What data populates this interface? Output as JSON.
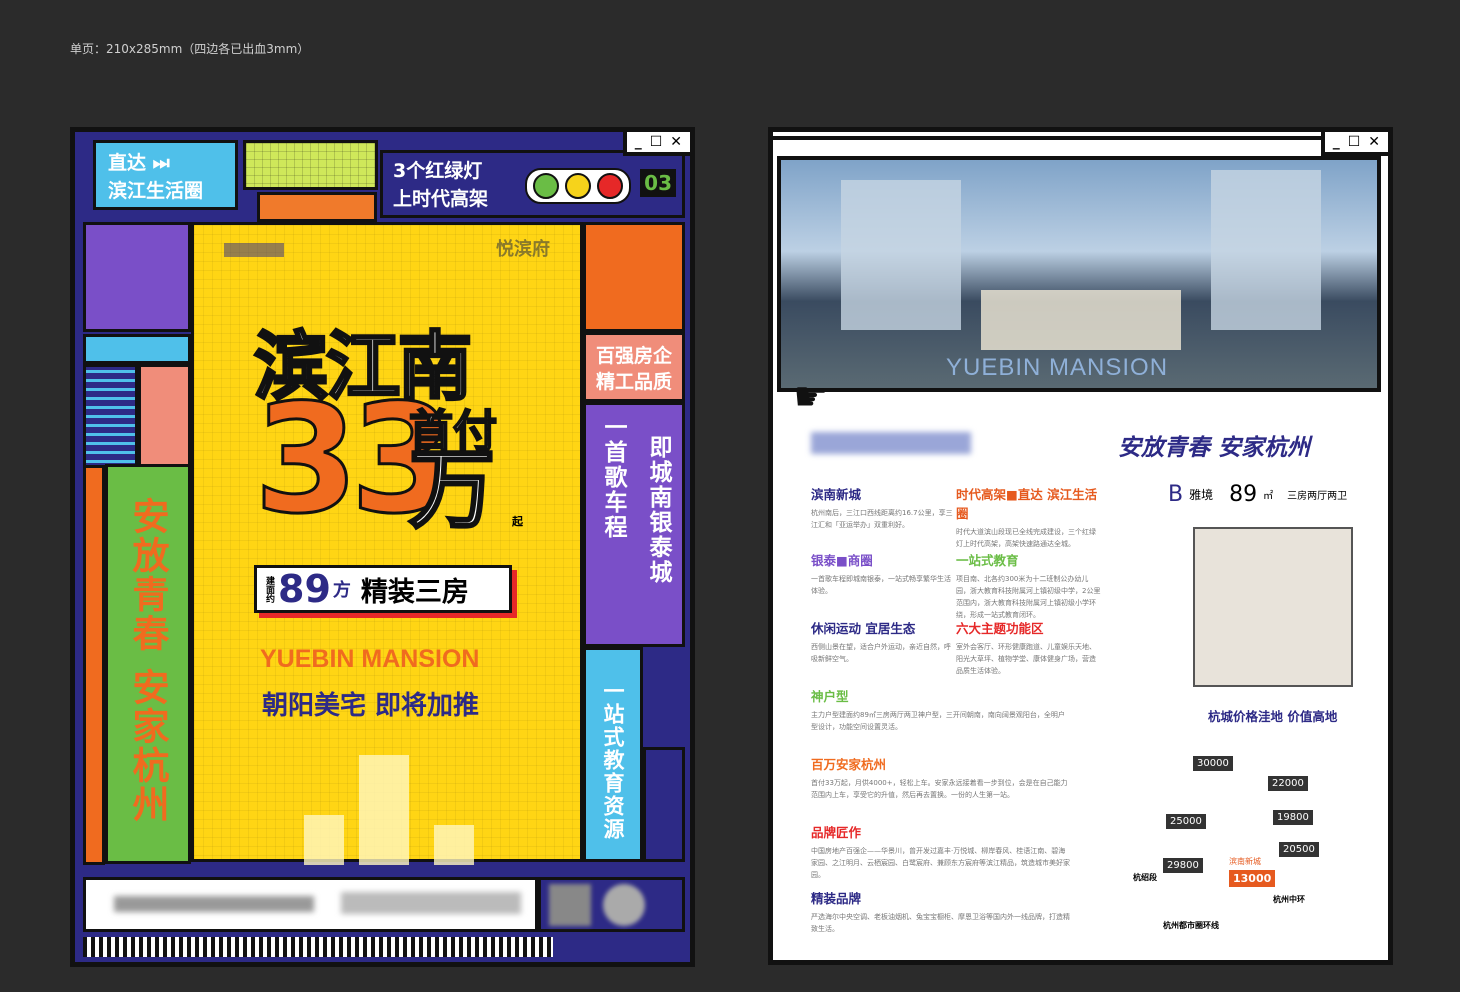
{
  "caption": "单页：210x285mm（四边各已出血3mm）",
  "front": {
    "badge": {
      "line1": "直达 ⏭",
      "line2": "滨江生活圈"
    },
    "traffic": {
      "line1": "3个红绿灯",
      "line2": "上时代高架",
      "number": "03"
    },
    "window_buttons": [
      "_",
      "☐",
      "✕"
    ],
    "brand_name": "悦滨府",
    "headline": "滨江南",
    "price_label": "首付",
    "price_value": "33",
    "price_unit": "万",
    "price_suffix": "起",
    "size_prefix": "建面约",
    "size_value": "89",
    "size_unit": "方",
    "size_desc": "精装三房",
    "eng_name": "YUEBIN MANSION",
    "slogan_line": "朝阳美宅 即将加推",
    "side_badge": {
      "line1": "百强房企",
      "line2": "精工品质"
    },
    "vert_left": "安放青春 安家杭州",
    "vert_song": "一首歌车程",
    "vert_city": "即城南银泰城",
    "vert_edu": "一站式教育资源"
  },
  "back": {
    "window_buttons": [
      "_",
      "☐",
      "✕"
    ],
    "hero_caption": "YUEBIN MANSION",
    "slogan": "安放青春 安家杭州",
    "sections": [
      {
        "title": "滨南新城",
        "body": "杭州南后，三江口西线距离约16.7公里，享三江汇和「亚运举办」双重利好。"
      },
      {
        "title": "时代高架■直达 滨江生活圈",
        "body": "时代大道滨山段现已全线完成建设，三个红绿灯上时代高架，高架快速路通达全城。"
      },
      {
        "title": "银泰■商圈",
        "body": "一首歌车程即城南银泰，一站式畅享繁华生活体验。"
      },
      {
        "title": "一站式教育",
        "body": "项目南、北各约300米为十二班制公办幼儿园，浙大教育科技附属河上镇初级中学，2公里范围内，浙大教育科技附属河上镇初级小学环绕，形成一站式教育闭环。"
      },
      {
        "title": "休闲运动 宜居生态",
        "body": "西侧山景在望，适合户外运动，亲近自然，呼吸新鲜空气。"
      },
      {
        "title": "六大主题功能区",
        "body": "室外会客厅、环形健康跑道、儿童娱乐天地、阳光大草坪、植物学堂、康体健身广场，营造品质生活体验。"
      },
      {
        "title": "神户型",
        "body": "主力户型建面约89㎡三房两厅两卫神户型，三开间朝南，南向阔景观阳台，全明户型设计，功能空间设置灵活。"
      },
      {
        "title": "百万安家杭州",
        "body": "首付33万起，月供4000+，轻松上车。安家永远接着看一步到位，会是在自己能力范围内上车，享受它的升值，然后再去置换。一份的人生第一站。"
      },
      {
        "title": "品牌匠作",
        "body": "中国房地产百强企——华景川，曾开发过嘉丰·万悦城、柳岸春风、桂语江南、碧海家园、之江明月、云栖宸园、白鹭宸府、兼顾东方宸府等滨江精品，筑造城市美好家园。"
      },
      {
        "title": "精装品牌",
        "body": "严选海尔中央空调、老板油烟机、兔宝宝橱柜、摩恩卫浴等国内外一线品牌，打造精致生活。"
      }
    ],
    "floorplan": {
      "type": "B",
      "name": "雅境",
      "area": "89",
      "area_unit": "㎡",
      "desc": "三房两厅两卫",
      "desc_en": "YUEBIN MANSION"
    },
    "map_title": "杭城价格洼地 价值高地",
    "prices": [
      "30000",
      "22000",
      "25000",
      "19800",
      "20500",
      "29800",
      "13000"
    ],
    "map_labels": [
      "杭州中环",
      "杭州都市圈环线",
      "杭绍段",
      "滨南新城"
    ]
  }
}
